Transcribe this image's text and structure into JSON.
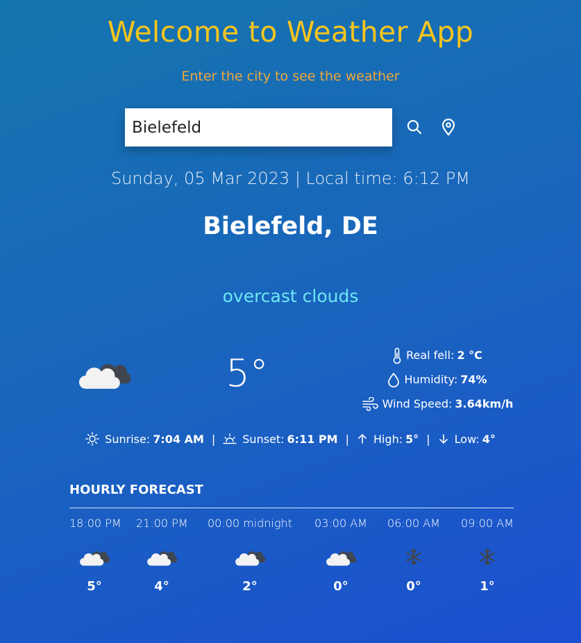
{
  "header": {
    "title": "Welcome to Weather App",
    "subtitle": "Enter the city to see the weather"
  },
  "search": {
    "value": "Bielefeld",
    "search_icon": "search-icon",
    "location_icon": "location-pin-icon"
  },
  "current": {
    "datetime": "Sunday, 05 Mar 2023 | Local time: 6:12 PM",
    "city": "Bielefeld, DE",
    "condition": "overcast clouds",
    "temperature": "5°",
    "icon": "cloudy-icon",
    "details": {
      "real_feel_label": "Real fell:",
      "real_feel_value": "2 °C",
      "humidity_label": "Humidity:",
      "humidity_value": "74%",
      "wind_label": "Wind Speed:",
      "wind_value": "3.64km/h"
    },
    "sun": {
      "sunrise_label": "Sunrise:",
      "sunrise_value": "7:04 AM",
      "sunset_label": "Sunset:",
      "sunset_value": "6:11 PM",
      "high_label": "High:",
      "high_value": "5°",
      "low_label": "Low:",
      "low_value": "4°",
      "separator": "|"
    }
  },
  "hourly": {
    "title": "HOURLY FORECAST",
    "items": [
      {
        "time": "18:00 PM",
        "temp": "5°",
        "icon": "cloudy-icon"
      },
      {
        "time": "21:00 PM",
        "temp": "4°",
        "icon": "cloudy-icon"
      },
      {
        "time": "00:00 midnight",
        "temp": "2°",
        "icon": "cloudy-icon"
      },
      {
        "time": "03:00 AM",
        "temp": "0°",
        "icon": "cloudy-icon"
      },
      {
        "time": "06:00 AM",
        "temp": "0°",
        "icon": "snowflake-icon"
      },
      {
        "time": "09:00 AM",
        "temp": "1°",
        "icon": "snowflake-icon"
      }
    ]
  },
  "colors": {
    "title": "#f7c51c",
    "subtitle": "#f0a73a",
    "condition": "#6ee6f4",
    "bg_start": "#1575ad",
    "bg_end": "#1b4fd1"
  }
}
